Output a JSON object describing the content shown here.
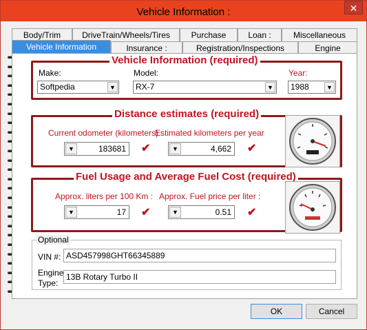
{
  "window": {
    "title": "Vehicle Information :",
    "close": "✕"
  },
  "tabs_back": [
    "Body/Trim",
    "DriveTrain/Wheels/Tires",
    "Purchase",
    "Loan :",
    "Miscellaneous"
  ],
  "tabs_front": [
    "Vehicle Information",
    "Insurance :",
    "Registration/Inspections",
    "Engine"
  ],
  "vehicle": {
    "title": "Vehicle Information (required)",
    "make_label": "Make:",
    "make_value": "Softpedia",
    "model_label": "Model:",
    "model_value": "RX-7",
    "year_label": "Year:",
    "year_value": "1988"
  },
  "distance": {
    "title": "Distance estimates (required)",
    "odometer_label": "Current odometer (kilometers) :",
    "odometer_value": "183681",
    "per_year_label": "Estimated kilometers per year",
    "per_year_value": "4,662"
  },
  "fuel": {
    "title": "Fuel Usage and Average Fuel Cost (required)",
    "liters_label": "Approx. liters per 100 Km :",
    "liters_value": "17",
    "price_label": "Approx. Fuel price per liter :",
    "price_value": "0.51"
  },
  "optional": {
    "label": "Optional",
    "vin_label": "VIN #:",
    "vin_value": "ASD457998GHT66345889",
    "engine_label_1": "Engine",
    "engine_label_2": "Type:",
    "engine_value": "13B Rotary Turbo II"
  },
  "buttons": {
    "ok": "OK",
    "cancel": "Cancel"
  },
  "icons": {
    "check": "✔",
    "dropdown": "▼"
  },
  "colors": {
    "titlebar": "#e8431e",
    "accent_red": "#c0141e",
    "section_border": "#8b1a1a",
    "active_tab": "#3c8dde"
  }
}
